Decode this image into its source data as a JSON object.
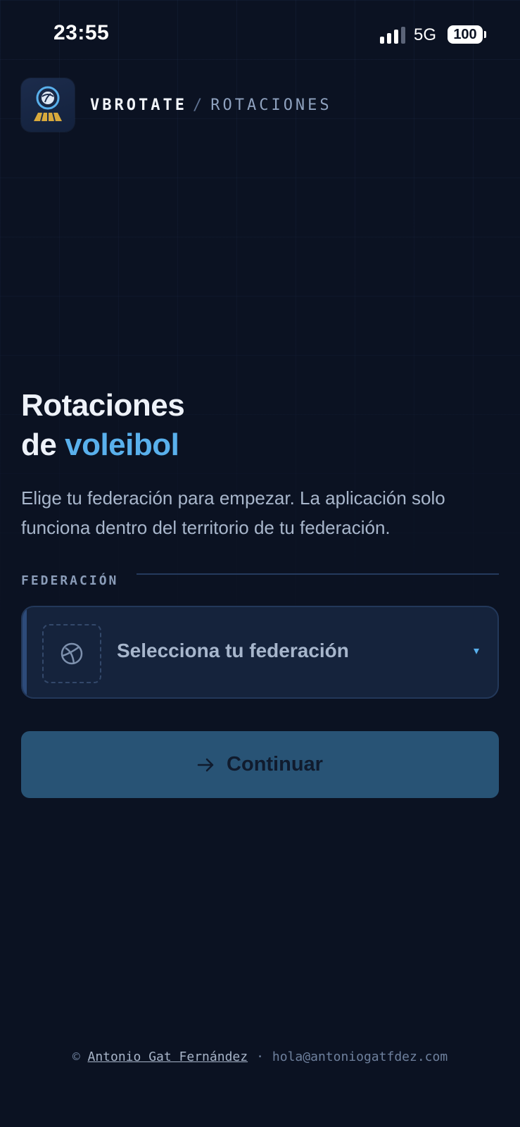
{
  "status_bar": {
    "time": "23:55",
    "network": "5G",
    "battery": "100"
  },
  "header": {
    "app_name": "VBROTATE",
    "separator": "/",
    "section": "ROTACIONES",
    "logo_icon": "volleyball-court-logo-icon"
  },
  "hero": {
    "title_line1": "Rotaciones",
    "title_line2_prefix": "de",
    "title_line2_accent": "voleibol",
    "subtitle": "Elige tu federación para empezar. La aplicación solo funciona dentro del territorio de tu federación."
  },
  "federation": {
    "label": "FEDERACIÓN",
    "placeholder": "Selecciona tu federación",
    "icon": "volleyball-icon",
    "caret": "▾"
  },
  "continue_button": {
    "label": "Continuar",
    "icon": "arrow-right-icon"
  },
  "footer": {
    "copyright": "©",
    "author": "Antonio Gat Fernández",
    "separator": "·",
    "email": "hola@antoniogatfdez.com"
  },
  "colors": {
    "background": "#0b1222",
    "accent": "#59b0ec",
    "button": "#285375",
    "select_bg": "#15233c"
  }
}
